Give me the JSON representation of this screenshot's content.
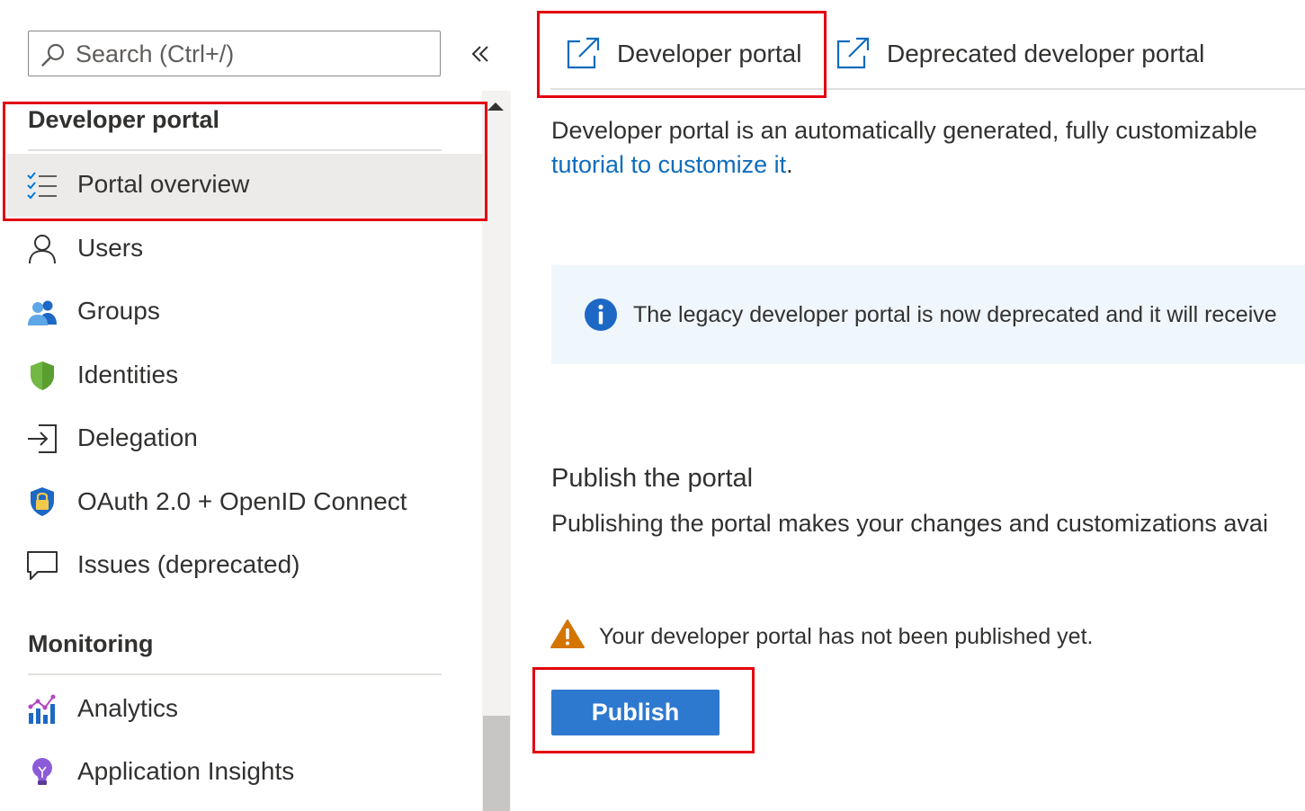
{
  "search": {
    "placeholder": "Search (Ctrl+/)"
  },
  "sidebar": {
    "sections": [
      {
        "title": "Developer portal",
        "items": [
          {
            "label": "Portal overview",
            "icon": "checklist-icon",
            "selected": true
          },
          {
            "label": "Users",
            "icon": "user-icon"
          },
          {
            "label": "Groups",
            "icon": "groups-icon"
          },
          {
            "label": "Identities",
            "icon": "shield-icon"
          },
          {
            "label": "Delegation",
            "icon": "sign-in-icon"
          },
          {
            "label": "OAuth 2.0 + OpenID Connect",
            "icon": "lock-shield-icon"
          },
          {
            "label": "Issues (deprecated)",
            "icon": "comment-icon"
          }
        ]
      },
      {
        "title": "Monitoring",
        "items": [
          {
            "label": "Analytics",
            "icon": "analytics-icon"
          },
          {
            "label": "Application Insights",
            "icon": "lightbulb-icon"
          }
        ]
      }
    ]
  },
  "tabs": [
    {
      "label": "Developer portal",
      "icon": "external-link-icon"
    },
    {
      "label": "Deprecated developer portal",
      "icon": "external-link-icon"
    }
  ],
  "main": {
    "description": "Developer portal is an automatically generated, fully customizable",
    "description_link": "tutorial to customize it",
    "description_end": ".",
    "info_text": "The legacy developer portal is now deprecated and it will receive",
    "publish_title": "Publish the portal",
    "publish_desc": "Publishing the portal makes your changes and customizations avai",
    "warning_text": "Your developer portal has not been published yet.",
    "publish_button": "Publish"
  },
  "colors": {
    "highlight_box": "#e3000f",
    "accent": "#0f6cbd",
    "button": "#2e79d0",
    "info_background": "#eff6fc",
    "warning": "#d47500",
    "selected_row": "#edebe9"
  }
}
